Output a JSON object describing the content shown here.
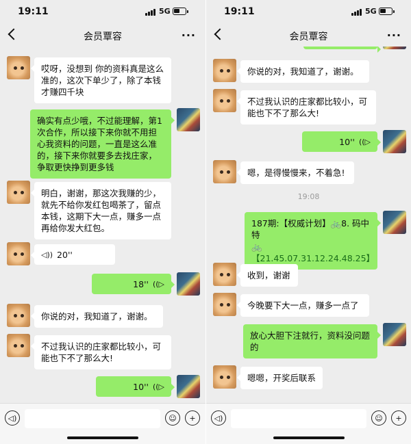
{
  "status_bar": {
    "time": "19:11",
    "network": "5G"
  },
  "nav": {
    "title": "会员覃容",
    "more": "···"
  },
  "left": {
    "messages": [
      {
        "text": "哎呀，没想到 你的资料真是这么准的，这次下单少了，除了本钱才赚四千块"
      },
      {
        "text": "确实有点少哦，不过能理解，第1次合作，所以接下来你就不用担心我资料的问题，一直是这么准的，接下来你就要多去找庄家，争取更快挣到更多钱"
      },
      {
        "text": "明白，谢谢，那这次我赚的少，就先不给你发红包喝茶了，留点本钱，这期下大一点，赚多一点再给你发大红包。"
      },
      {
        "duration": "20''"
      },
      {
        "duration": "18''"
      },
      {
        "text": "你说的对，我知道了，谢谢。"
      },
      {
        "text": "不过我认识的庄家都比较小，可能也下不了那么大!"
      },
      {
        "duration": "10''"
      }
    ]
  },
  "right": {
    "messages": [
      {
        "text": "你说的对，我知道了，谢谢。"
      },
      {
        "text": "不过我认识的庄家都比较小，可能也下不了那么大!"
      },
      {
        "duration": "10''"
      },
      {
        "text": "嗯，是得慢慢来，不着急!"
      },
      {
        "timestamp": "19:08"
      },
      {
        "text_a": "187期:【权威计划】",
        "text_b": "8. 码中特",
        "numbers": "【21.45.07.31.12.24.48.25】"
      },
      {
        "text": "收到，谢谢"
      },
      {
        "text": "今晚要下大一点，赚多一点了"
      },
      {
        "text": "放心大胆下注就行，资料没问题的"
      },
      {
        "text": "嗯嗯，开奖后联系"
      }
    ]
  },
  "colors": {
    "bubble_out": "#95ec69",
    "bubble_in": "#ffffff",
    "background": "#ededed"
  },
  "icons": {
    "voice": "voice-icon",
    "emoji": "emoji-icon",
    "plus": "plus-icon",
    "bike": "bicycle-icon"
  }
}
